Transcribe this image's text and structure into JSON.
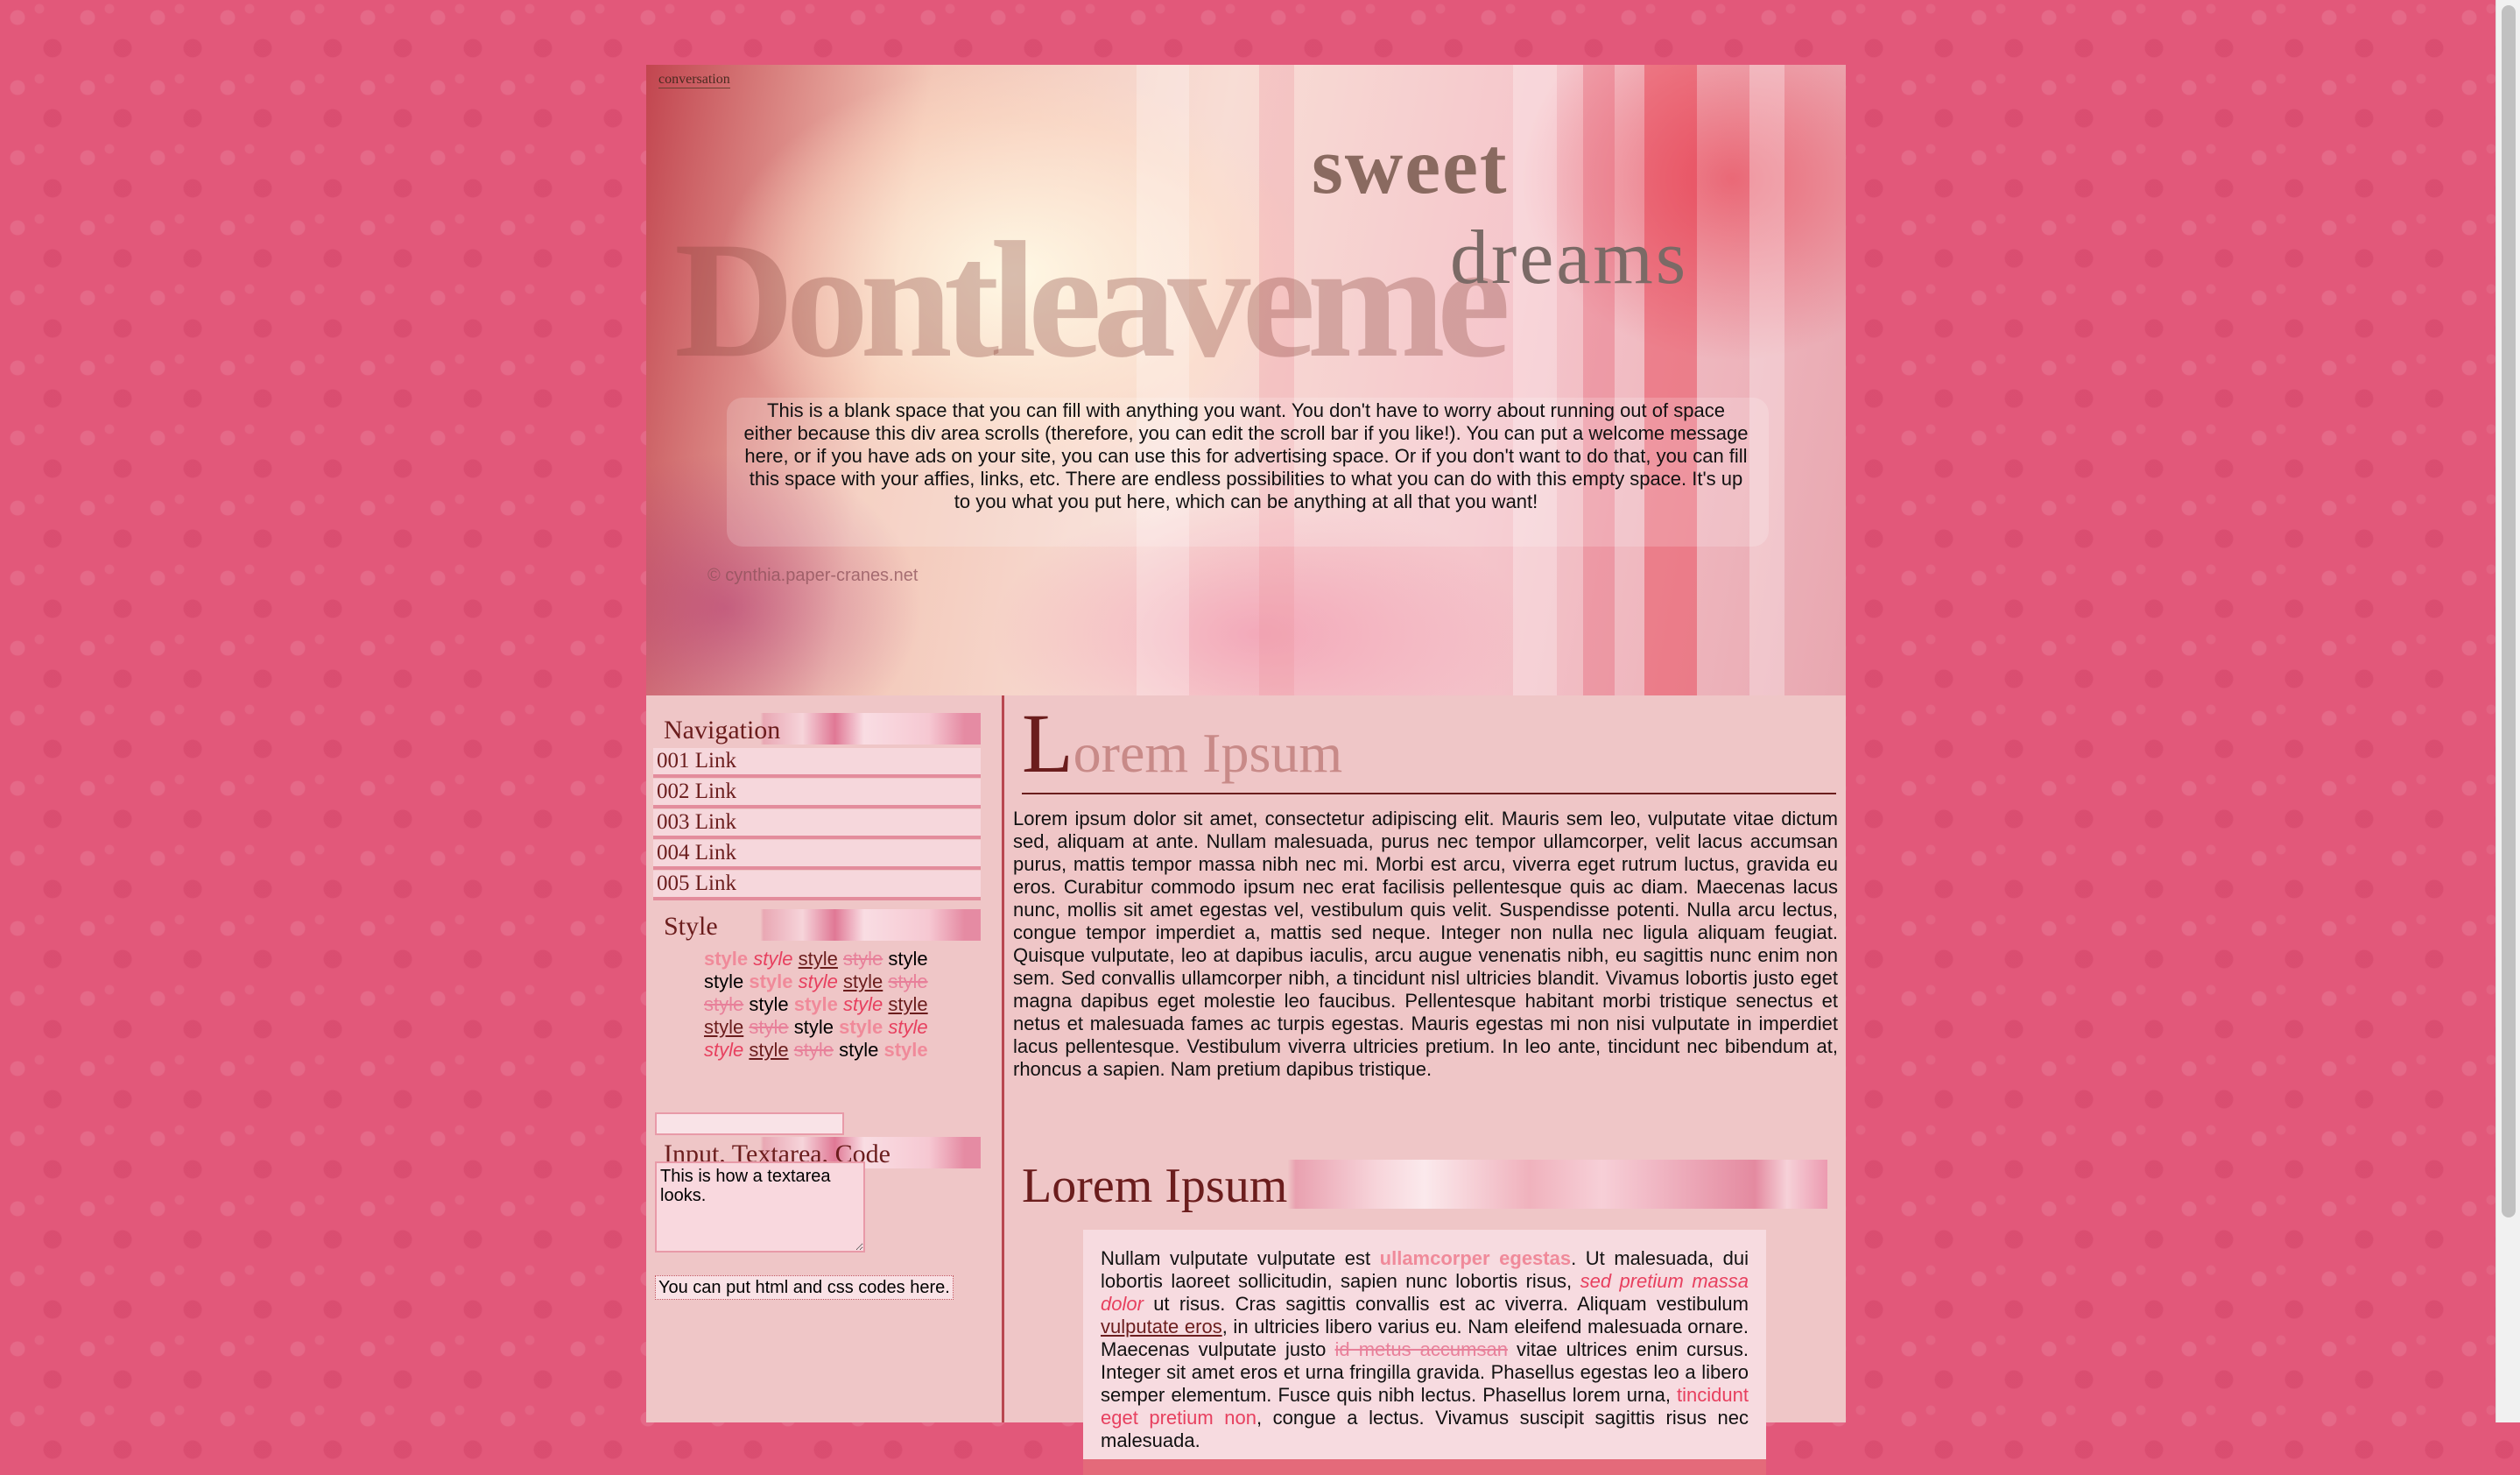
{
  "header": {
    "brand": "conversation",
    "decorative_word": "Dontleaveme",
    "title_sweet": "sweet",
    "title_dreams": "dreams",
    "welcome": "This is a blank space that you can fill with anything you want. You don't have to worry about running out of space either because this div area scrolls (therefore, you can edit the scroll bar if you like!). You can put a welcome message here, or if you have ads on your site, you can use this for advertising space. Or if you don't want to do that, you can fill this space with your affies, links, etc. There are endless possibilities to what you can do with this empty space. It's up to you what you put here, which can be anything at all that you want!",
    "credit": "© cynthia.paper-cranes.net"
  },
  "sidebar": {
    "nav_title": "Navigation",
    "links": [
      "001 Link",
      "002 Link",
      "003 Link",
      "004 Link",
      "005 Link"
    ],
    "style_title": "Style",
    "style_word": "style",
    "input_title": "Input, Textarea, Code",
    "input_value": "",
    "textarea_value": "This is how a textarea looks.",
    "code_note": "You can put html and css codes here."
  },
  "main": {
    "heading1_first": "L",
    "heading1_rest": "orem Ipsum",
    "paragraph1": "Lorem ipsum dolor sit amet, consectetur adipiscing elit. Mauris sem leo, vulputate vitae dictum sed, aliquam at ante. Nullam malesuada, purus nec tempor ullamcorper, velit lacus accumsan purus, mattis tempor massa nibh nec mi. Morbi est arcu, viverra eget rutrum luctus, gravida eu eros. Curabitur commodo ipsum nec erat facilisis pellentesque quis ac diam. Maecenas lacus nunc, mollis sit amet egestas vel, vestibulum quis velit. Suspendisse potenti. Nulla arcu lectus, congue tempor imperdiet a, mattis sed neque. Integer non nulla nec ligula aliquam feugiat. Quisque vulputate, leo at dapibus iaculis, arcu augue venenatis nibh, eu sagittis nunc enim non sem. Sed convallis ullamcorper nibh, a tincidunt nisl ultricies blandit. Vivamus lobortis justo eget magna dapibus eget molestie leo faucibus. Pellentesque habitant morbi tristique senectus et netus et malesuada fames ac turpis egestas. Mauris egestas mi non nisi vulputate in imperdiet lacus pellentesque. Vestibulum viverra ultricies pretium. In leo ante, tincidunt nec bibendum at, rhoncus a sapien. Nam pretium dapibus tristique.",
    "heading2": "Lorem Ipsum",
    "quote": {
      "t1": "Nullam vulputate vulputate est ",
      "bold": "ullamcorper egestas",
      "t2": ". Ut malesuada, dui lobortis laoreet sollicitudin, sapien nunc lobortis risus, ",
      "italic": "sed pretium massa dolor",
      "t3": " ut risus. Cras sagittis convallis est ac viverra. Aliquam vestibulum ",
      "underline": "vulputate eros",
      "t4": ", in ultricies libero varius eu. Nam eleifend malesuada ornare. Maecenas vulputate justo ",
      "strike": "id metus accumsan",
      "t5": " vitae ultrices enim cursus. Integer sit amet eros et urna fringilla gravida. Phasellus egestas leo a libero semper elementum. Fusce quis nibh lectus. Phasellus lorem urna, ",
      "pink": "tincidunt eget pretium non",
      "t6": ", congue a lectus. Vivamus suscipit sagittis risus nec malesuada."
    }
  },
  "colors": {
    "background": "#e2587a",
    "panel": "#efc6c7",
    "heading_dark": "#6b1d1d",
    "accent_pink": "#e7405f",
    "divider": "#b8474f"
  }
}
